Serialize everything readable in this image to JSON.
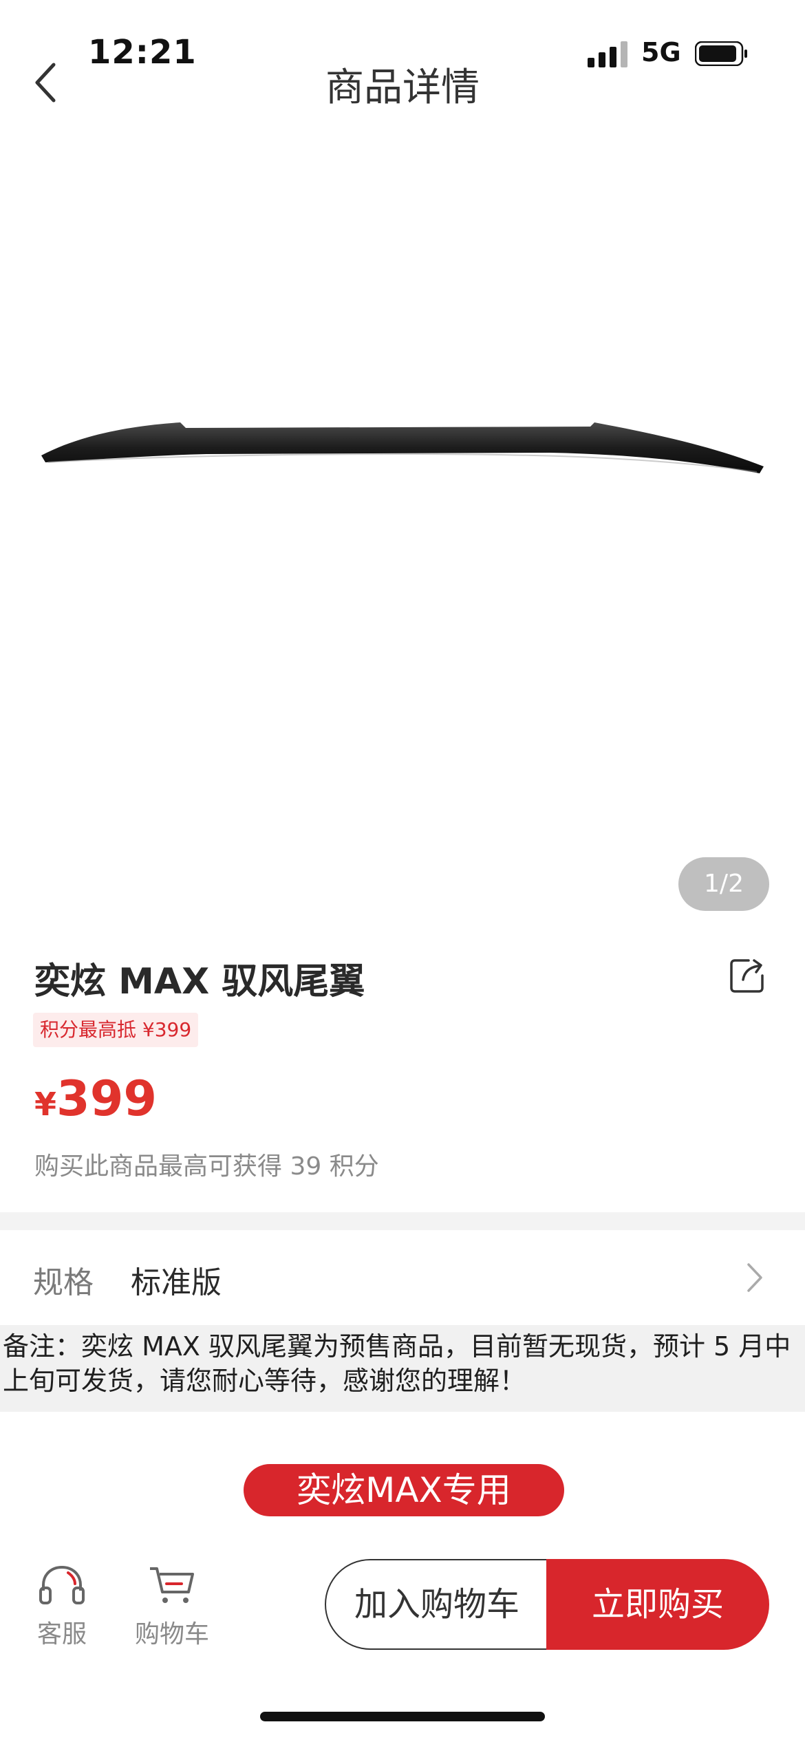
{
  "status_bar": {
    "time": "12:21",
    "network": "5G"
  },
  "nav": {
    "title": "商品详情"
  },
  "gallery": {
    "counter": "1/2"
  },
  "product": {
    "title": "奕炫 MAX 驭风尾翼",
    "points_badge": "积分最高抵 ¥399",
    "price_currency": "¥",
    "price_value": "399",
    "points_earn": "购买此商品最高可获得 39 积分"
  },
  "spec": {
    "label": "规格",
    "value": "标准版"
  },
  "note": {
    "text": "备注：奕炫 MAX 驭风尾翼为预售商品，目前暂无现货，预计 5 月中上旬可发货，请您耐心等待，感谢您的理解！"
  },
  "detail": {
    "banner": "奕炫MAX专用"
  },
  "bottom_bar": {
    "service_label": "客服",
    "cart_label": "购物车",
    "add_to_cart": "加入购物车",
    "buy_now": "立即购买"
  },
  "colors": {
    "accent": "#d8262c",
    "price": "#e0332c"
  }
}
